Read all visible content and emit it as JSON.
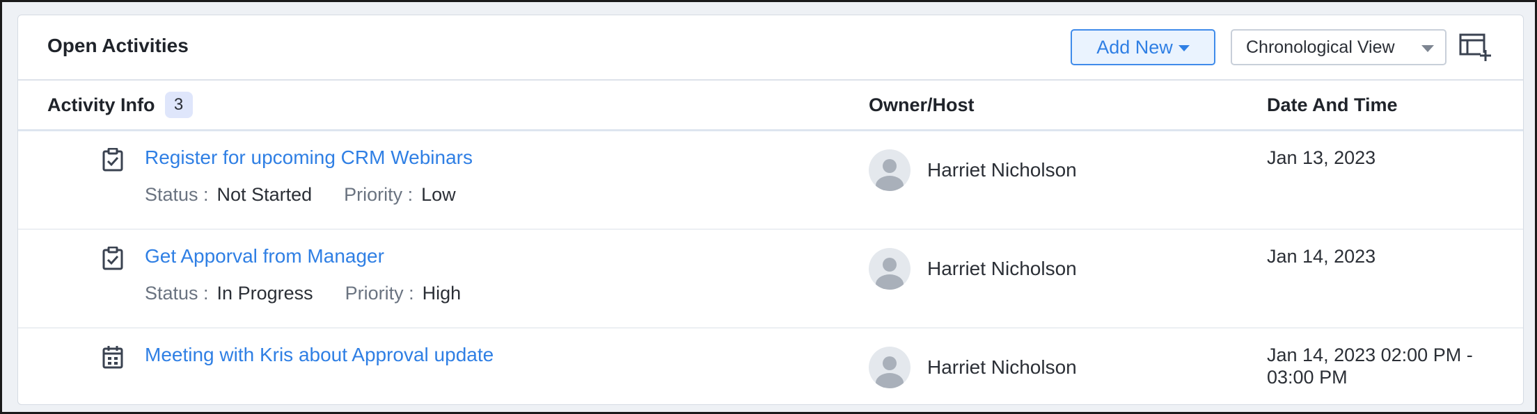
{
  "header": {
    "title": "Open Activities",
    "add_new_label": "Add New",
    "view_select_value": "Chronological View",
    "layout_icon": "table-add-column-icon"
  },
  "columns": {
    "activity_info": "Activity Info",
    "activity_count": "3",
    "owner_host": "Owner/Host",
    "date_time": "Date And Time"
  },
  "labels": {
    "status": "Status :",
    "priority": "Priority :"
  },
  "activities": [
    {
      "icon": "task-checkbox-icon",
      "title": "Register for upcoming CRM Webinars",
      "status": "Not Started",
      "priority": "Low",
      "owner": "Harriet Nicholson",
      "datetime": "Jan 13, 2023"
    },
    {
      "icon": "task-checkbox-icon",
      "title": "Get Apporval from Manager",
      "status": "In Progress",
      "priority": "High",
      "owner": "Harriet Nicholson",
      "datetime": "Jan 14, 2023"
    },
    {
      "icon": "calendar-icon",
      "title": "Meeting with Kris about Approval update",
      "owner": "Harriet Nicholson",
      "datetime": "Jan 14, 2023 02:00 PM - 03:00 PM"
    }
  ],
  "colors": {
    "link": "#2f7fe4",
    "accent_bg": "#eaf3fe",
    "badge_bg": "#dfe6fb"
  }
}
